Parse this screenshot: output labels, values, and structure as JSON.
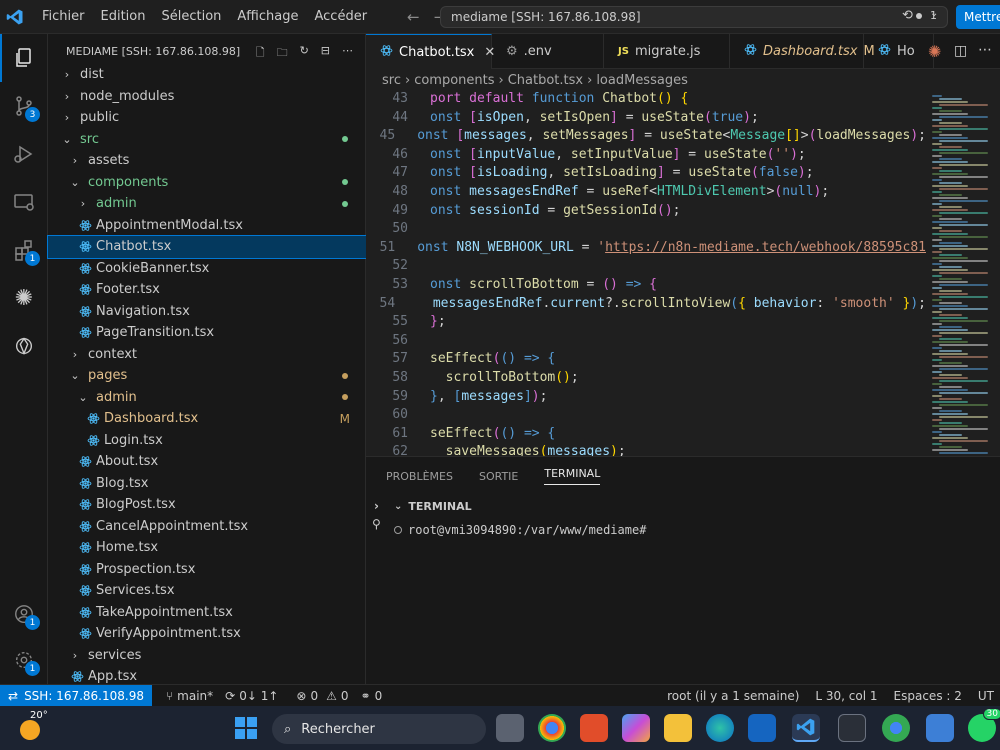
{
  "menu": [
    "Fichier",
    "Edition",
    "Sélection",
    "Affichage",
    "Accéder"
  ],
  "search": {
    "text": "mediame [SSH: 167.86.108.98]",
    "count": "1"
  },
  "update_button": "Mettre",
  "explorer": {
    "title": "MEDIAME [SSH: 167.86.108.98]",
    "items": [
      {
        "label": "dist",
        "depth": 0,
        "type": "folder",
        "open": false
      },
      {
        "label": "node_modules",
        "depth": 0,
        "type": "folder",
        "open": false
      },
      {
        "label": "public",
        "depth": 0,
        "type": "folder",
        "open": false
      },
      {
        "label": "src",
        "depth": 0,
        "type": "folder",
        "open": true,
        "color": "#73c991",
        "dot": "#73c991"
      },
      {
        "label": "assets",
        "depth": 1,
        "type": "folder",
        "open": false
      },
      {
        "label": "components",
        "depth": 1,
        "type": "folder",
        "open": true,
        "color": "#73c991",
        "dot": "#73c991"
      },
      {
        "label": "admin",
        "depth": 2,
        "type": "folder",
        "open": false,
        "color": "#73c991",
        "dot": "#73c991"
      },
      {
        "label": "AppointmentModal.tsx",
        "depth": 2,
        "type": "file"
      },
      {
        "label": "Chatbot.tsx",
        "depth": 2,
        "type": "file",
        "selected": true
      },
      {
        "label": "CookieBanner.tsx",
        "depth": 2,
        "type": "file"
      },
      {
        "label": "Footer.tsx",
        "depth": 2,
        "type": "file"
      },
      {
        "label": "Navigation.tsx",
        "depth": 2,
        "type": "file"
      },
      {
        "label": "PageTransition.tsx",
        "depth": 2,
        "type": "file"
      },
      {
        "label": "context",
        "depth": 1,
        "type": "folder",
        "open": false
      },
      {
        "label": "pages",
        "depth": 1,
        "type": "folder",
        "open": true,
        "color": "#e2c08d",
        "dot": "#c59f5e"
      },
      {
        "label": "admin",
        "depth": 2,
        "type": "folder",
        "open": true,
        "color": "#e2c08d",
        "dot": "#c59f5e"
      },
      {
        "label": "Dashboard.tsx",
        "depth": 3,
        "type": "file",
        "color": "#e2c08d",
        "mark": "M"
      },
      {
        "label": "Login.tsx",
        "depth": 3,
        "type": "file"
      },
      {
        "label": "About.tsx",
        "depth": 2,
        "type": "file"
      },
      {
        "label": "Blog.tsx",
        "depth": 2,
        "type": "file"
      },
      {
        "label": "BlogPost.tsx",
        "depth": 2,
        "type": "file"
      },
      {
        "label": "CancelAppointment.tsx",
        "depth": 2,
        "type": "file"
      },
      {
        "label": "Home.tsx",
        "depth": 2,
        "type": "file"
      },
      {
        "label": "Prospection.tsx",
        "depth": 2,
        "type": "file"
      },
      {
        "label": "Services.tsx",
        "depth": 2,
        "type": "file"
      },
      {
        "label": "TakeAppointment.tsx",
        "depth": 2,
        "type": "file"
      },
      {
        "label": "VerifyAppointment.tsx",
        "depth": 2,
        "type": "file"
      },
      {
        "label": "services",
        "depth": 1,
        "type": "folder",
        "open": false
      },
      {
        "label": "App.tsx",
        "depth": 1,
        "type": "file"
      }
    ]
  },
  "tabs": [
    {
      "label": "Chatbot.tsx",
      "icon": "react",
      "active": true,
      "close": "✕"
    },
    {
      "label": ".env",
      "icon": "gear"
    },
    {
      "label": "migrate.js",
      "icon": "js"
    },
    {
      "label": "Dashboard.tsx",
      "icon": "react",
      "modified": "M",
      "italic": true
    },
    {
      "label": "Ho",
      "icon": "react"
    }
  ],
  "breadcrumb": [
    "src",
    "components",
    "Chatbot.tsx",
    "loadMessages"
  ],
  "code": [
    {
      "n": "43",
      "html": "<span class='pk'>port</span> <span class='pk'>default</span> <span class='kw'>function</span> <span class='fn'>Chatbot</span><span class='pu'>()</span> <span class='pu'>{</span>"
    },
    {
      "n": "44",
      "html": "<span class='kw'>onst</span> <span class='pk'>[</span><span class='vr'>isOpen</span>, <span class='fn'>setIsOpen</span><span class='pk'>]</span> = <span class='fn'>useState</span><span class='pk'>(</span><span class='kw'>true</span><span class='pk'>)</span>;"
    },
    {
      "n": "45",
      "html": "<span class='kw'>onst</span> <span class='pk'>[</span><span class='vr'>messages</span>, <span class='fn'>setMessages</span><span class='pk'>]</span> = <span class='fn'>useState</span>&lt;<span class='ty'>Message</span><span class='pu'>[]</span>&gt;<span class='pk'>(</span><span class='fn'>loadMessages</span><span class='pk'>)</span>;"
    },
    {
      "n": "46",
      "html": "<span class='kw'>onst</span> <span class='pk'>[</span><span class='vr'>inputValue</span>, <span class='fn'>setInputValue</span><span class='pk'>]</span> = <span class='fn'>useState</span><span class='pk'>(</span><span class='st'>''</span><span class='pk'>)</span>;"
    },
    {
      "n": "47",
      "html": "<span class='kw'>onst</span> <span class='pk'>[</span><span class='vr'>isLoading</span>, <span class='fn'>setIsLoading</span><span class='pk'>]</span> = <span class='fn'>useState</span><span class='pk'>(</span><span class='kw'>false</span><span class='pk'>)</span>;"
    },
    {
      "n": "48",
      "html": "<span class='kw'>onst</span> <span class='vr'>messagesEndRef</span> = <span class='fn'>useRef</span>&lt;<span class='ty'>HTMLDivElement</span>&gt;<span class='pk'>(</span><span class='kw'>null</span><span class='pk'>)</span>;"
    },
    {
      "n": "49",
      "html": "<span class='kw'>onst</span> <span class='vr'>sessionId</span> = <span class='fn'>getSessionId</span><span class='pk'>()</span>;"
    },
    {
      "n": "50",
      "html": ""
    },
    {
      "n": "51",
      "html": "<span class='kw'>onst</span> <span class='vr'>N8N_WEBHOOK_URL</span> = <span class='st'>'<u>https://n8n-mediame.tech/webhook/88595c81</u></span>"
    },
    {
      "n": "52",
      "html": ""
    },
    {
      "n": "53",
      "html": "<span class='kw'>onst</span> <span class='fn'>scrollToBottom</span> = <span class='pk'>()</span> <span class='kw'>=&gt;</span> <span class='pk'>{</span>"
    },
    {
      "n": "54",
      "html": "  <span class='vr'>messagesEndRef</span>.<span class='vr'>current</span>?.<span class='fn'>scrollIntoView</span><span class='kw'>(</span><span class='pu'>{</span> <span class='vr'>behavior</span>: <span class='st'>'smooth'</span> <span class='pu'>}</span><span class='kw'>)</span>;"
    },
    {
      "n": "55",
      "html": "<span class='pk'>}</span>;"
    },
    {
      "n": "56",
      "html": ""
    },
    {
      "n": "57",
      "html": "<span class='fn'>seEffect</span><span class='pk'>(</span><span class='kw'>()</span> <span class='kw'>=&gt;</span> <span class='kw'>{</span>"
    },
    {
      "n": "58",
      "html": "  <span class='fn'>scrollToBottom</span><span class='pu'>()</span>;"
    },
    {
      "n": "59",
      "html": "<span class='kw'>}</span>, <span class='kw'>[</span><span class='vr'>messages</span><span class='kw'>]</span><span class='pk'>)</span>;"
    },
    {
      "n": "60",
      "html": ""
    },
    {
      "n": "61",
      "html": "<span class='fn'>seEffect</span><span class='pk'>(</span><span class='kw'>()</span> <span class='kw'>=&gt;</span> <span class='kw'>{</span>"
    },
    {
      "n": "62",
      "html": "  <span class='fn'>saveMessages</span><span class='pu'>(</span><span class='vr'>messages</span><span class='pu'>)</span>;"
    }
  ],
  "panel": {
    "tabs": [
      "PROBLÈMES",
      "SORTIE",
      "TERMINAL"
    ],
    "terminal_title": "TERMINAL",
    "prompt": "root@vmi3094890:/var/www/mediame#"
  },
  "status": {
    "remote": "SSH: 167.86.108.98",
    "branch": "main*",
    "sync": "0↓ 1↑",
    "errors": "0",
    "warnings": "0",
    "ports": "0",
    "blame": "root (il y a 1 semaine)",
    "position": "L 30, col 1",
    "spaces": "Espaces : 2",
    "encoding": "UT"
  },
  "taskbar": {
    "weather": "20°",
    "search": "Rechercher",
    "whatsapp_count": "30"
  },
  "badges": {
    "scm": "3",
    "extensions": "1",
    "accounts": "1",
    "settings": "1"
  },
  "colors": {
    "accent": "#0078d4",
    "modified": "#e2c08d",
    "untracked": "#73c991"
  }
}
